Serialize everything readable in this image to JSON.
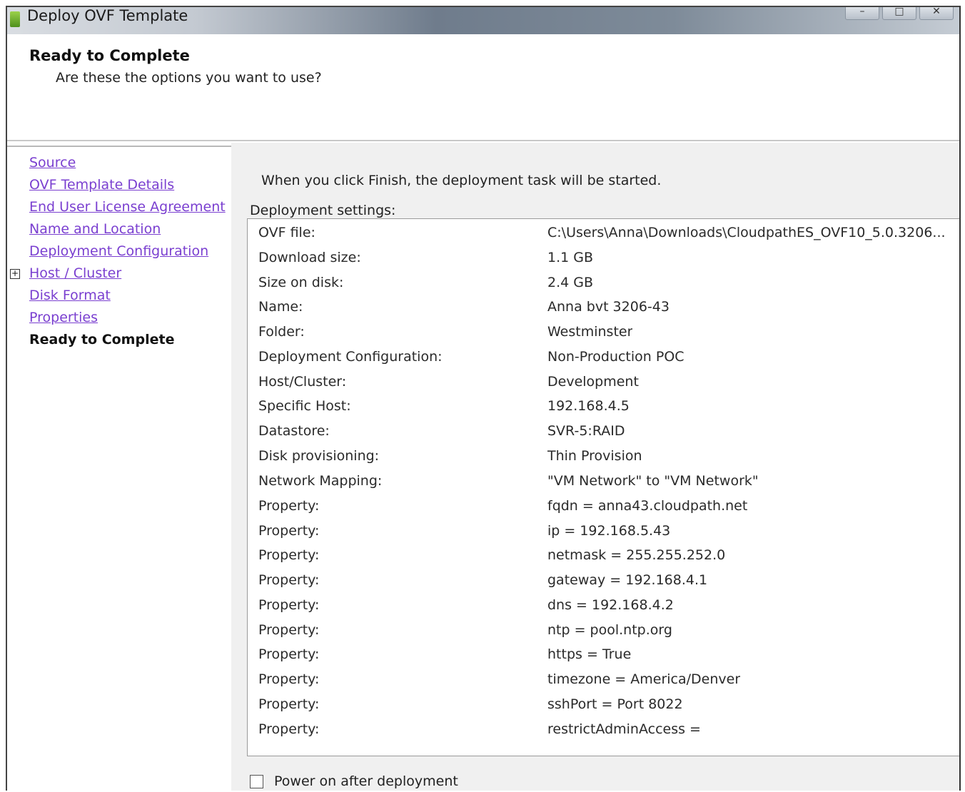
{
  "window": {
    "title": "Deploy OVF Template",
    "controls": [
      "–",
      "□",
      "✕"
    ]
  },
  "header": {
    "title": "Ready to Complete",
    "subtitle": "Are these the options you want to use?"
  },
  "steps": [
    {
      "label": "Source",
      "type": "link"
    },
    {
      "label": "OVF Template Details",
      "type": "link"
    },
    {
      "label": "End User License Agreement",
      "type": "link"
    },
    {
      "label": "Name and Location",
      "type": "link"
    },
    {
      "label": "Deployment Configuration",
      "type": "link"
    },
    {
      "label": "Host / Cluster",
      "type": "link",
      "expandable": true
    },
    {
      "label": "Disk Format",
      "type": "link"
    },
    {
      "label": "Properties",
      "type": "link"
    },
    {
      "label": "Ready to Complete",
      "type": "current"
    }
  ],
  "main": {
    "intro": "When you click Finish, the deployment task will be started.",
    "settings_label": "Deployment settings:",
    "settings": [
      {
        "key": "OVF file:",
        "value": "C:\\Users\\Anna\\Downloads\\CloudpathES_OVF10_5.0.3206..."
      },
      {
        "key": "Download size:",
        "value": "1.1 GB"
      },
      {
        "key": "Size on disk:",
        "value": "2.4 GB"
      },
      {
        "key": "Name:",
        "value": "Anna bvt 3206-43"
      },
      {
        "key": "Folder:",
        "value": "Westminster"
      },
      {
        "key": "Deployment Configuration:",
        "value": "Non-Production POC"
      },
      {
        "key": "Host/Cluster:",
        "value": "Development"
      },
      {
        "key": "Specific Host:",
        "value": "192.168.4.5"
      },
      {
        "key": "Datastore:",
        "value": "SVR-5:RAID"
      },
      {
        "key": "Disk provisioning:",
        "value": "Thin Provision"
      },
      {
        "key": "Network Mapping:",
        "value": "\"VM Network\" to \"VM Network\""
      },
      {
        "key": "Property:",
        "value": "fqdn = anna43.cloudpath.net"
      },
      {
        "key": "Property:",
        "value": "ip = 192.168.5.43"
      },
      {
        "key": "Property:",
        "value": "netmask = 255.255.252.0"
      },
      {
        "key": "Property:",
        "value": "gateway = 192.168.4.1"
      },
      {
        "key": "Property:",
        "value": "dns = 192.168.4.2"
      },
      {
        "key": "Property:",
        "value": "ntp = pool.ntp.org"
      },
      {
        "key": "Property:",
        "value": "https = True"
      },
      {
        "key": "Property:",
        "value": "timezone = America/Denver"
      },
      {
        "key": "Property:",
        "value": "sshPort = Port 8022"
      },
      {
        "key": "Property:",
        "value": "restrictAdminAccess ="
      }
    ],
    "power_on_label": "Power on after deployment",
    "power_on_checked": false
  }
}
